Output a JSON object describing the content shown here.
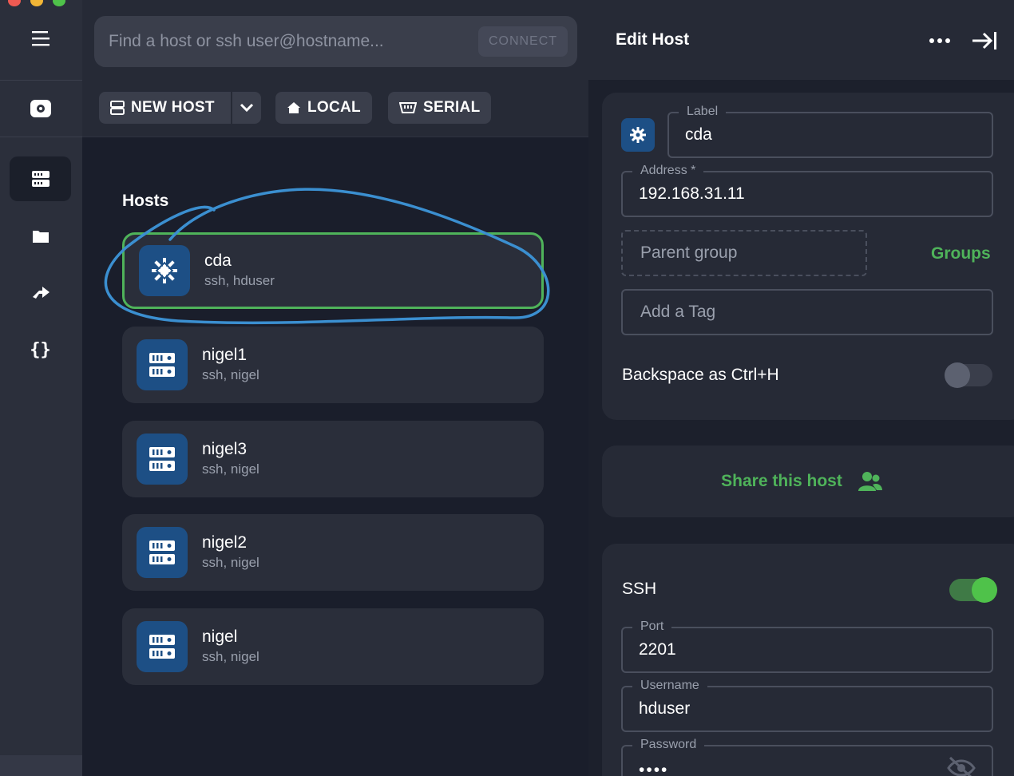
{
  "rail": {
    "items": [
      {
        "name": "menu"
      },
      {
        "name": "keychain"
      },
      {
        "name": "hosts",
        "active": true
      },
      {
        "name": "sftp"
      },
      {
        "name": "port-forwarding"
      },
      {
        "name": "snippets"
      }
    ]
  },
  "search": {
    "placeholder": "Find a host or ssh user@hostname...",
    "connect_label": "CONNECT"
  },
  "toolbar": {
    "new_host_label": "NEW HOST",
    "local_label": "LOCAL",
    "serial_label": "SERIAL"
  },
  "hosts_section": {
    "title": "Hosts",
    "items": [
      {
        "name": "cda",
        "sub": "ssh, hduser",
        "selected": true,
        "icon": "centos-icon"
      },
      {
        "name": "nigel1",
        "sub": "ssh, nigel",
        "selected": false,
        "icon": "server-icon"
      },
      {
        "name": "nigel3",
        "sub": "ssh, nigel",
        "selected": false,
        "icon": "server-icon"
      },
      {
        "name": "nigel2",
        "sub": "ssh, nigel",
        "selected": false,
        "icon": "server-icon"
      },
      {
        "name": "nigel",
        "sub": "ssh, nigel",
        "selected": false,
        "icon": "server-icon"
      }
    ]
  },
  "edit_host": {
    "title": "Edit Host",
    "label_field": {
      "label": "Label",
      "value": "cda"
    },
    "address_field": {
      "label": "Address *",
      "value": "192.168.31.11"
    },
    "parent_group": {
      "placeholder": "Parent group",
      "groups_link": "Groups"
    },
    "tag_field": {
      "placeholder": "Add a Tag"
    },
    "backspace_toggle": {
      "label": "Backspace as Ctrl+H",
      "on": false
    },
    "share_label": "Share this host",
    "ssh": {
      "label": "SSH",
      "on": true,
      "port": {
        "label": "Port",
        "value": "2201"
      },
      "username": {
        "label": "Username",
        "value": "hduser"
      },
      "password": {
        "label": "Password",
        "value": "••••"
      }
    }
  },
  "colors": {
    "accent_green": "#4fb35a",
    "host_icon_blue": "#1d4f85",
    "annotation_blue": "#3b8fd0"
  }
}
